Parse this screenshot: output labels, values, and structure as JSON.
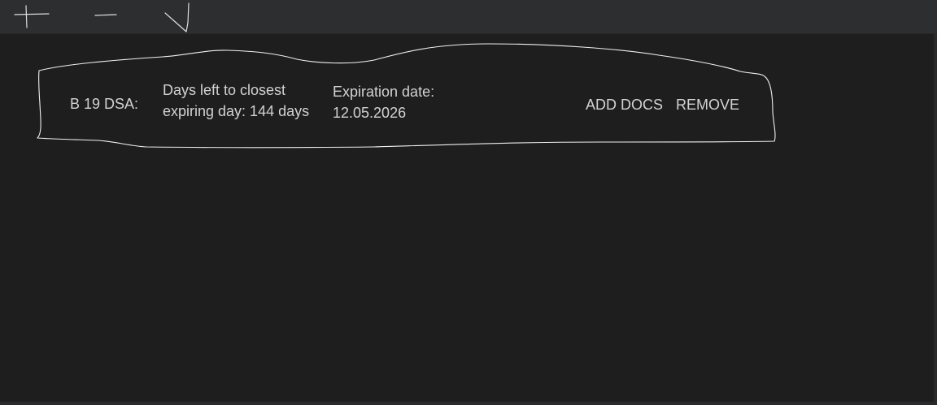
{
  "toolbar": {
    "buttons": [
      {
        "name": "add",
        "icon": "plus-icon"
      },
      {
        "name": "remove",
        "icon": "minus-icon"
      },
      {
        "name": "confirm",
        "icon": "check-icon"
      }
    ]
  },
  "card": {
    "name": "B 19 DSA:",
    "days_left_line1": "Days left to closest",
    "days_left_line2": "expiring day: 144 days",
    "expiration_label": "Expiration date:",
    "expiration_value": "12.05.2026",
    "add_docs_label": "ADD DOCS",
    "remove_label": "REMOVE"
  },
  "colors": {
    "background": "#1e1e1e",
    "toolbar": "#2d2e30",
    "text": "#d2d2d2",
    "sketch": "#e8e8e8"
  }
}
